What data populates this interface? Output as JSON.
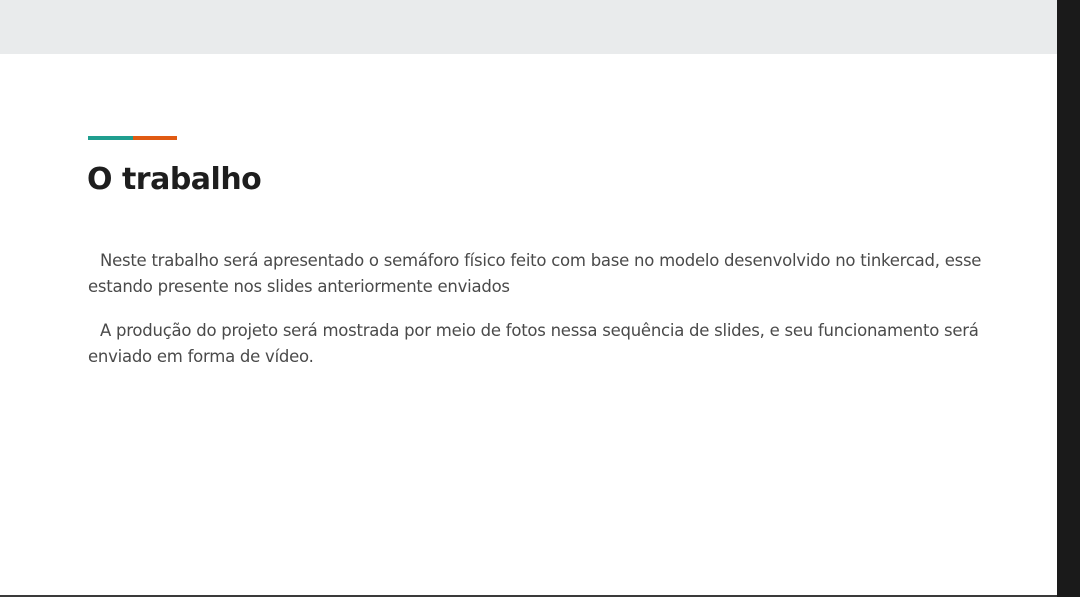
{
  "slide": {
    "title": "O trabalho",
    "paragraphs": [
      "Neste trabalho será apresentado o semáforo físico feito com base no modelo desenvolvido no tinkercad, esse estando presente nos slides anteriormente enviados",
      "A produção do projeto será mostrada por meio de fotos nessa sequência de slides, e seu funcionamento será enviado em forma de vídeo."
    ]
  },
  "colors": {
    "accent_teal": "#1f9e8f",
    "accent_orange": "#e05a12",
    "title": "#1e1e1e",
    "body_text": "#4a4a4a",
    "top_bar": "#e9ebec"
  }
}
